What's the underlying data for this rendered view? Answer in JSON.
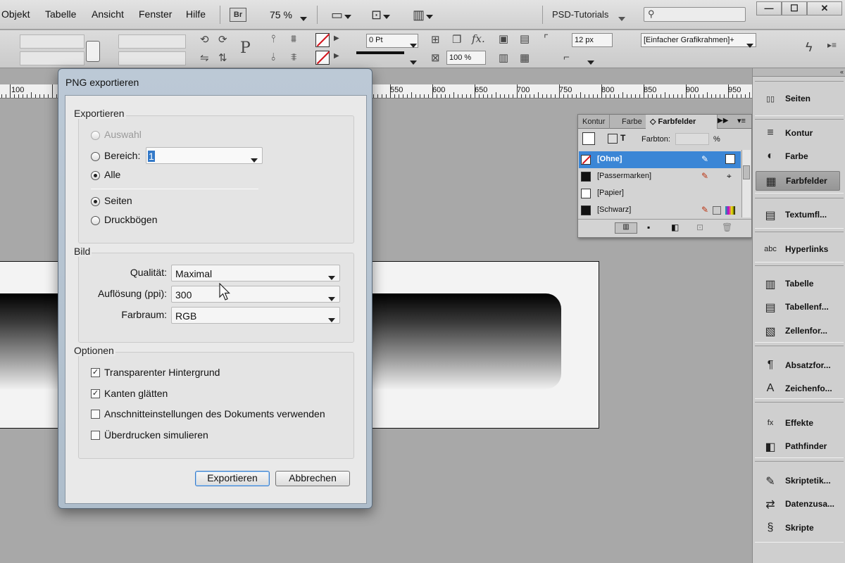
{
  "menubar": {
    "items": [
      "Objekt",
      "Tabelle",
      "Ansicht",
      "Fenster",
      "Hilfe"
    ],
    "bridge_badge": "Br",
    "zoom": "75 %",
    "workspace": "PSD-Tutorials",
    "search_placeholder": "",
    "window_min": "—",
    "window_max": "☐",
    "window_close": "✕"
  },
  "controlbar": {
    "stroke_weight": "0 Pt",
    "corner_size": "12 px",
    "opacity": "100 %",
    "object_style": "[Einfacher Grafikrahmen]+",
    "p_glyph": "P",
    "fx_label": "fx."
  },
  "ruler": {
    "labels": [
      "100",
      "550",
      "600",
      "650",
      "700",
      "750",
      "800",
      "850",
      "900",
      "950"
    ]
  },
  "swatch_panel": {
    "tabs": [
      "Kontur",
      "Farbe",
      "◇ Farbfelder"
    ],
    "tint_label": "Farbton:",
    "tint_value": "",
    "tint_unit": "%",
    "swatches": [
      {
        "name": "[Ohne]",
        "color": "#ffffff"
      },
      {
        "name": "[Passermarken]",
        "color": "#111111"
      },
      {
        "name": "[Papier]",
        "color": "#ffffff"
      },
      {
        "name": "[Schwarz]",
        "color": "#111111"
      }
    ]
  },
  "dock": {
    "items": [
      {
        "label": "Seiten",
        "icon": "pages-icon",
        "glyph": "▯▯"
      },
      {
        "label": "Kontur",
        "icon": "stroke-icon",
        "glyph": "≡"
      },
      {
        "label": "Farbe",
        "icon": "color-palette-icon",
        "glyph": "◐"
      },
      {
        "label": "Farbfelder",
        "icon": "swatches-grid-icon",
        "glyph": "▦"
      },
      {
        "label": "Textumfl...",
        "icon": "text-wrap-icon",
        "glyph": "▤"
      },
      {
        "label": "Hyperlinks",
        "icon": "hyperlink-icon",
        "glyph": "abc"
      },
      {
        "label": "Tabelle",
        "icon": "table-icon",
        "glyph": "▥"
      },
      {
        "label": "Tabellenf...",
        "icon": "table-styles-icon",
        "glyph": "▤"
      },
      {
        "label": "Zellenfor...",
        "icon": "cell-styles-icon",
        "glyph": "▧"
      },
      {
        "label": "Absatzfor...",
        "icon": "paragraph-styles-icon",
        "glyph": "¶"
      },
      {
        "label": "Zeichenfo...",
        "icon": "character-styles-icon",
        "glyph": "A"
      },
      {
        "label": "Effekte",
        "icon": "effects-fx-icon",
        "glyph": "fx"
      },
      {
        "label": "Pathfinder",
        "icon": "pathfinder-icon",
        "glyph": "◧"
      },
      {
        "label": "Skriptetik...",
        "icon": "script-label-icon",
        "glyph": "✎"
      },
      {
        "label": "Datenzusa...",
        "icon": "data-merge-icon",
        "glyph": "⇄"
      },
      {
        "label": "Skripte",
        "icon": "scripts-icon",
        "glyph": "§"
      }
    ],
    "collapse_glyph": "«"
  },
  "dialog": {
    "title": "PNG exportieren",
    "export_group": {
      "title": "Exportieren",
      "auswahl": "Auswahl",
      "bereich": "Bereich:",
      "bereich_value": "1",
      "alle": "Alle",
      "seiten": "Seiten",
      "druckboegen": "Druckbögen"
    },
    "bild_group": {
      "title": "Bild",
      "qualitaet_label": "Qualität:",
      "qualitaet_value": "Maximal",
      "aufloesung_label": "Auflösung (ppi):",
      "aufloesung_value": "300",
      "farbraum_label": "Farbraum:",
      "farbraum_value": "RGB"
    },
    "optionen_group": {
      "title": "Optionen",
      "transparent": "Transparenter Hintergrund",
      "kanten": "Kanten glätten",
      "anschnitt": "Anschnitteinstellungen des Dokuments verwenden",
      "ueberdrucken": "Überdrucken simulieren"
    },
    "export_button": "Exportieren",
    "cancel_button": "Abbrechen"
  }
}
